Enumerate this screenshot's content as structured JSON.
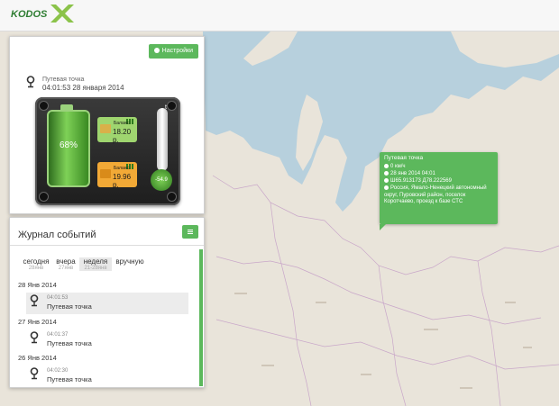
{
  "status_panel": {
    "settings_label": "Настройки",
    "point_title": "Путевая точка",
    "point_time": "04:01:53 28 января 2014",
    "battery_percent": "68%",
    "balance1_label": "Баланс:",
    "balance1_value": "18.20 р.",
    "balance2_label": "Баланс:",
    "balance2_value": "19.96 р.",
    "temp_unit": "t°C",
    "temp_value": "-54.9"
  },
  "journal": {
    "title": "Журнал событий",
    "tabs": [
      {
        "label": "сегодня",
        "sub": "28янв"
      },
      {
        "label": "вчера",
        "sub": "27янв"
      },
      {
        "label": "неделя",
        "sub": "21-28янв"
      },
      {
        "label": "вручную",
        "sub": ""
      }
    ],
    "groups": [
      {
        "date": "28 Янв 2014",
        "time": "04:01:53",
        "name": "Путевая точка"
      },
      {
        "date": "27 Янв 2014",
        "time": "04:01:37",
        "name": "Путевая точка"
      },
      {
        "date": "26 Янв 2014",
        "time": "04:02:30",
        "name": "Путевая точка"
      }
    ]
  },
  "popup": {
    "title": "Путевая точка",
    "speed": "0 км/ч",
    "datetime": "28 янв 2014 04:01",
    "coords": "Ш65.913173 Д78.222569",
    "address": "Россия, Ямало-Ненецкий автономный округ, Пуровский район, поселок Коротчаево, проезд к базе СТС"
  },
  "colors": {
    "accent": "#5cb85c",
    "map_land": "#e9e4da",
    "map_water": "#b7d0dd"
  }
}
